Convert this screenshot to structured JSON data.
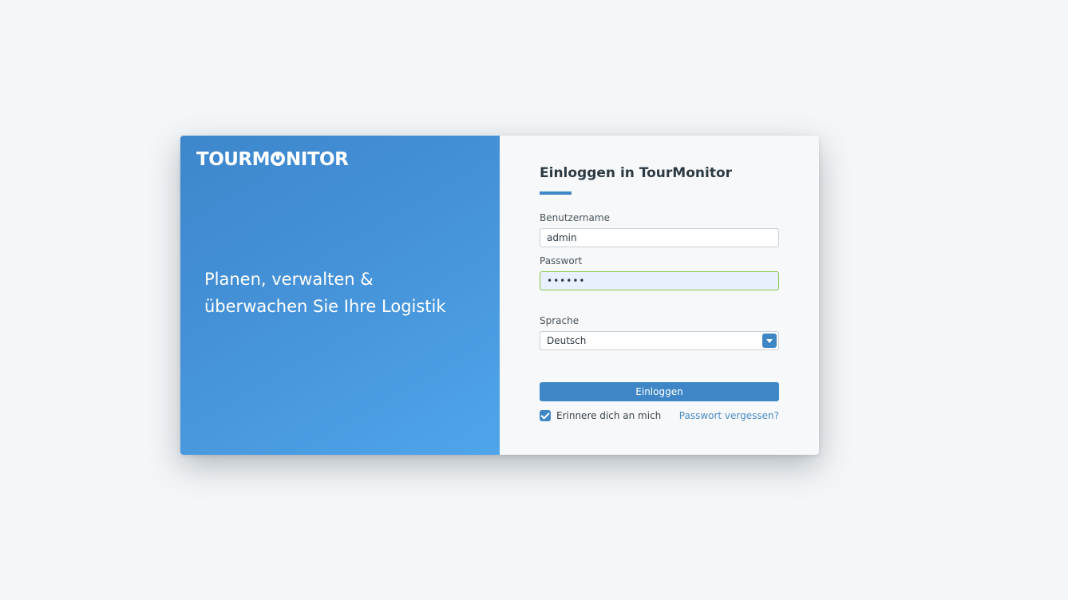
{
  "brand": {
    "logo_left": "TOURM",
    "logo_right": "NITOR",
    "tagline": "Planen, verwalten & überwachen Sie Ihre Logistik"
  },
  "form": {
    "title": "Einloggen in TourMonitor",
    "username_label": "Benutzername",
    "username_value": "admin",
    "password_label": "Passwort",
    "password_value": "••••••",
    "language_label": "Sprache",
    "language_selected": "Deutsch",
    "login_button": "Einloggen",
    "remember_label": "Erinnere dich an mich",
    "remember_checked": true,
    "forgot_link": "Passwort vergessen?"
  },
  "colors": {
    "accent": "#3f86c7",
    "brand_gradient_start": "#3d86cc",
    "brand_gradient_end": "#4fa5ea",
    "valid_border": "#8bc34a"
  }
}
